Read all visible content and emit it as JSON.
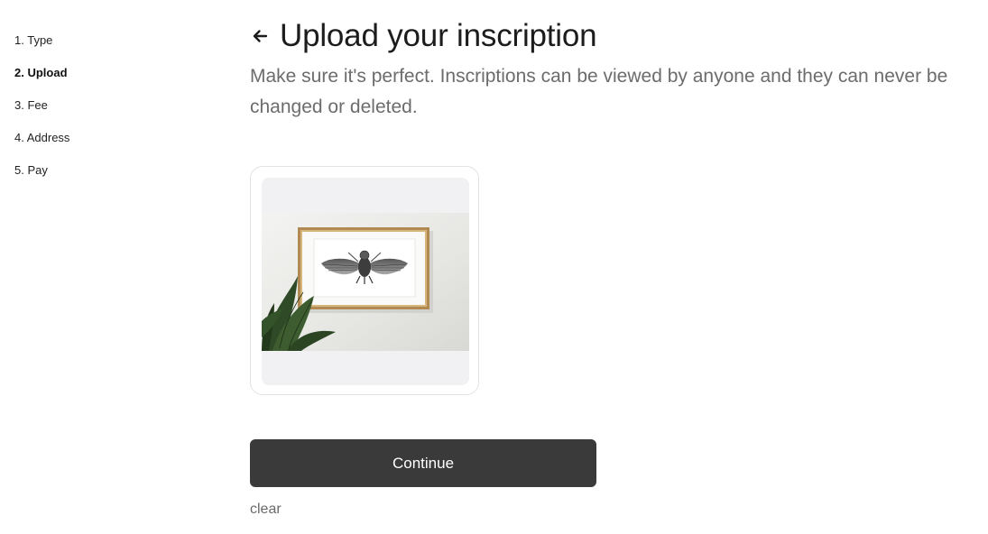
{
  "sidebar": {
    "steps": [
      {
        "label": "1. Type",
        "active": false
      },
      {
        "label": "2. Upload",
        "active": true
      },
      {
        "label": "3. Fee",
        "active": false
      },
      {
        "label": "4. Address",
        "active": false
      },
      {
        "label": "5. Pay",
        "active": false
      }
    ]
  },
  "main": {
    "title": "Upload your inscription",
    "subtitle": "Make sure it's perfect. Inscriptions can be viewed by anyone and they can never be changed or deleted.",
    "continue_label": "Continue",
    "clear_label": "clear"
  },
  "icons": {
    "back": "arrow-left-icon"
  },
  "colors": {
    "button_bg": "#3a3a3a",
    "card_border": "#e3e3e6",
    "preview_bg": "#f1f1f3",
    "subtitle_text": "#6c6c6c"
  }
}
